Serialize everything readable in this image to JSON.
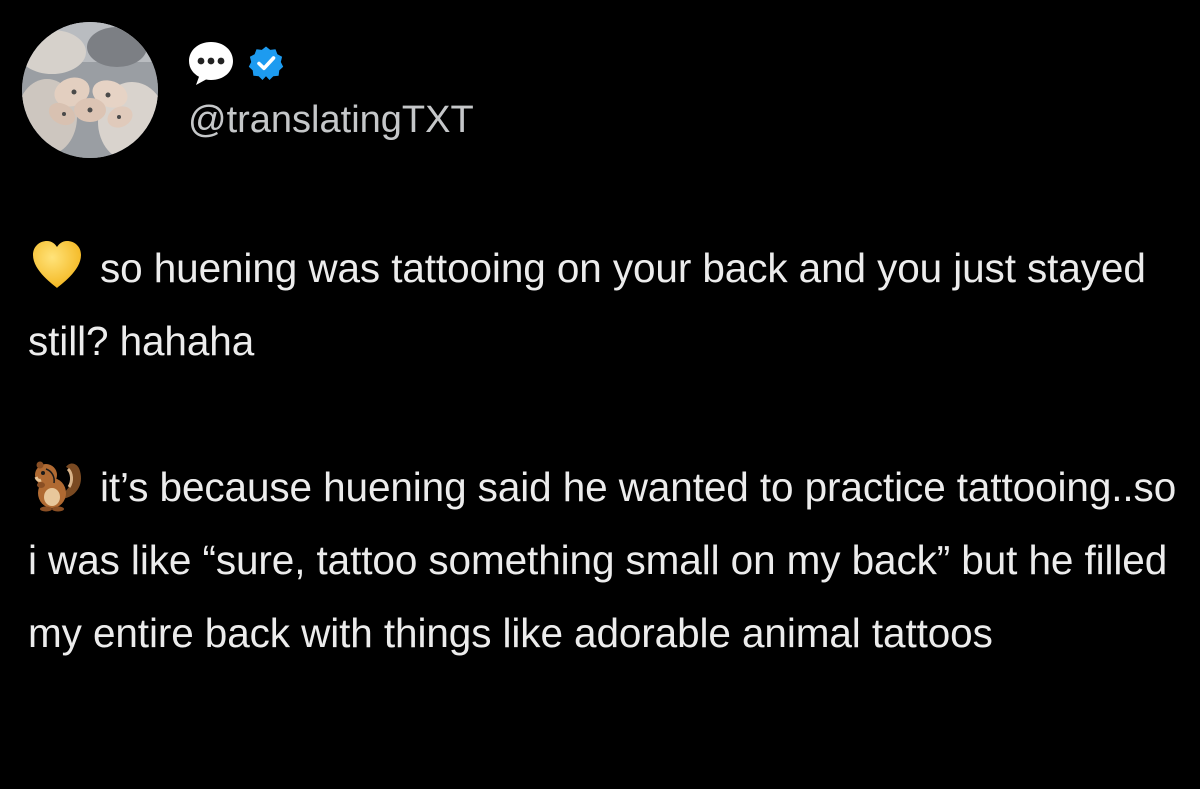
{
  "profile": {
    "avatar_icon": "avatar-photo-hands",
    "name_icon": "speech-bubble-icon",
    "verified_icon": "verified-badge-icon",
    "verified_color": "#1d9bf0",
    "handle": "@translatingTXT"
  },
  "tweet": {
    "paragraphs": [
      {
        "icon": "yellow-heart-icon",
        "text": "so huening was tattooing on your back and you just stayed still? hahaha"
      },
      {
        "icon": "chipmunk-icon",
        "text": "it’s because huening said he wanted to practice tattooing..so i was like “sure, tattoo something small on my back” but he filled my entire back with things like adorable animal tattoos"
      }
    ]
  },
  "colors": {
    "background": "#000000",
    "text": "#ececec",
    "handle": "#c5c7c9"
  }
}
